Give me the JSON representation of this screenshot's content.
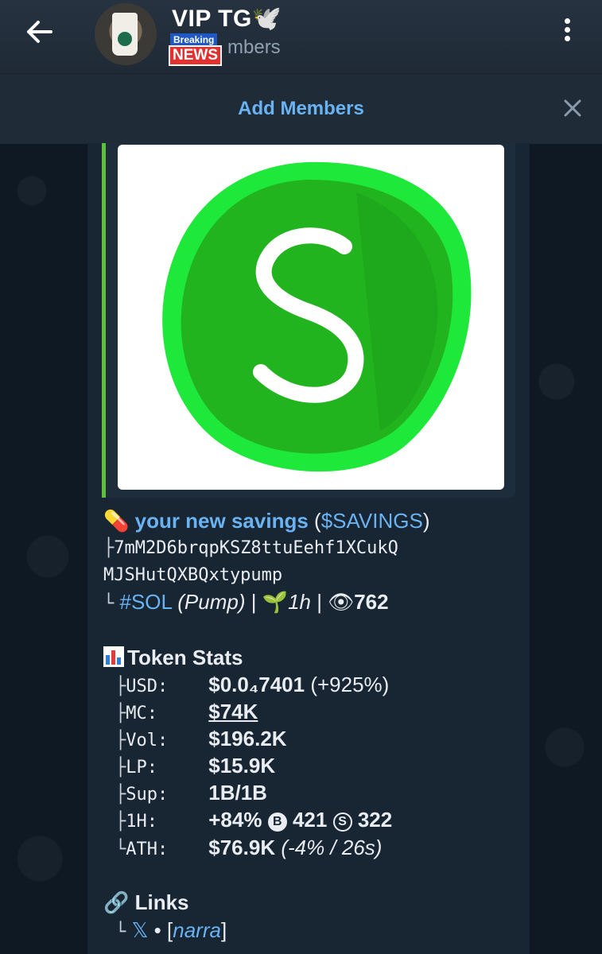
{
  "header": {
    "title": "VIP TG",
    "title_emoji": "🕊️",
    "subtitle_fragment": "mbers",
    "badge_top": "Breaking",
    "badge_bottom": "NEWS"
  },
  "banner": {
    "add_members": "Add Members"
  },
  "message": {
    "token_line": {
      "emoji": "💊",
      "name": "your new savings",
      "open_paren": " (",
      "ticker": "$SAVINGS",
      "close_paren": ")"
    },
    "address_line1_prefix": "├",
    "address_line1": "7mM2D6brqpKSZ8ttuEehf1XCukQ",
    "address_line2": "MJSHutQXBQxtypump",
    "info_prefix": "└",
    "chain": "#SOL",
    "platform": "(Pump)",
    "sep1": " | ",
    "age_emoji": "🌱",
    "age": "1h",
    "sep2": " | ",
    "views_emoji": "👁",
    "views": "762",
    "stats_title": "Token Stats",
    "stats": [
      {
        "prefix": "├",
        "label": "USD:",
        "value": "$0.0₄7401",
        "extra": " (+925%)"
      },
      {
        "prefix": "├",
        "label": "MC:",
        "value": "$74K",
        "extra": ""
      },
      {
        "prefix": "├",
        "label": "Vol:",
        "value": "$196.2K",
        "extra": ""
      },
      {
        "prefix": "├",
        "label": "LP:",
        "value": "$15.9K",
        "extra": ""
      },
      {
        "prefix": "├",
        "label": "Sup:",
        "value": "1B/1B",
        "extra": ""
      },
      {
        "prefix": "├",
        "label": "1H:",
        "value": "+84%",
        "extra": ""
      },
      {
        "prefix": "└",
        "label": "ATH:",
        "value": "$76.9K",
        "extra": " (-4% / 26s)"
      }
    ],
    "h1_buy_icon": "B",
    "h1_buys": "421",
    "h1_sell_icon": "S",
    "h1_sells": "322",
    "links_emoji": "🔗",
    "links_title": "Links",
    "links_prefix": "└",
    "x_link": "𝕏",
    "bullet": " • ",
    "narra_open": "[",
    "narra": "narra",
    "narra_close": "]"
  },
  "colors": {
    "accent": "#6ab3f3",
    "logo_green": "#22c32a",
    "logo_ring": "#1ee83a"
  }
}
